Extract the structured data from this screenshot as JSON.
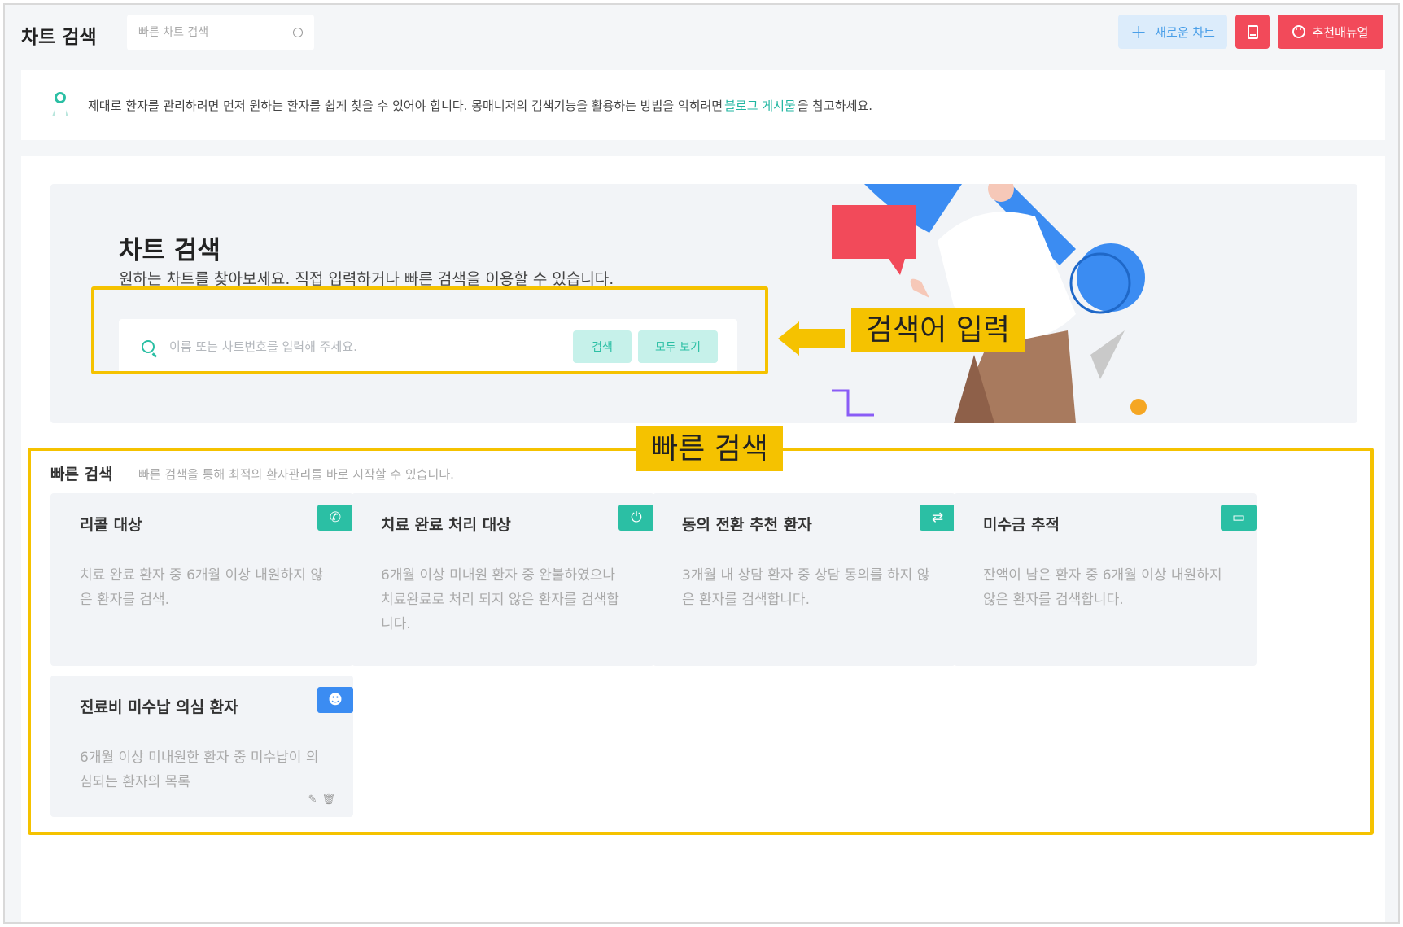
{
  "header": {
    "title": "차트 검색",
    "quick_search_placeholder": "빠른 차트 검색",
    "new_chart_label": "새로운 차트",
    "manual_label": "추천매뉴얼"
  },
  "info": {
    "text_before": "제대로 환자를 관리하려면 먼저 원하는 환자를 쉽게 찾을 수 있어야 합니다. 몽매니저의 검색기능을 활용하는 방법을 익히려면",
    "link_text": "블로그 게시물",
    "text_after": "을 참고하세요."
  },
  "hero": {
    "title": "차트 검색",
    "subtitle": "원하는 차트를 찾아보세요. 직접 입력하거나 빠른 검색을 이용할 수 있습니다.",
    "search_placeholder": "이름 또는 차트번호를 입력해 주세요.",
    "search_button": "검색",
    "all_button": "모두 보기"
  },
  "annotations": {
    "search_label": "검색어 입력",
    "quick_label": "빠른 검색"
  },
  "quick_search": {
    "title": "빠른 검색",
    "description": "빠른 검색을 통해 최적의 환자관리를 바로 시작할 수 있습니다.",
    "cards": [
      {
        "title": "리콜 대상",
        "description": "치료 완료 환자 중 6개월 이상 내원하지 않은 환자를 검색.",
        "icon": "phone-icon"
      },
      {
        "title": "치료 완료 처리 대상",
        "description": "6개월 이상 미내원 환자 중 완불하였으나 치료완료로 처리 되지 않은 환자를 검색합니다.",
        "icon": "power-icon"
      },
      {
        "title": "동의 전환 추천 환자",
        "description": "3개월 내 상담 환자 중 상담 동의를 하지 않은 환자를 검색합니다.",
        "icon": "swap-icon"
      },
      {
        "title": "미수금 추적",
        "description": "잔액이 남은 환자 중 6개월 이상 내원하지 않은 환자를 검색합니다.",
        "icon": "note-icon"
      },
      {
        "title": "진료비 미수납 의심 환자",
        "description": "6개월 이상 미내원한 환자 중 미수납이 의심되는 환자의 목록",
        "icon": "user-search-icon"
      }
    ]
  },
  "colors": {
    "accent": "#2bbfa4",
    "danger": "#f24a5a",
    "blue": "#3b8cf2",
    "highlight": "#f5c200"
  }
}
